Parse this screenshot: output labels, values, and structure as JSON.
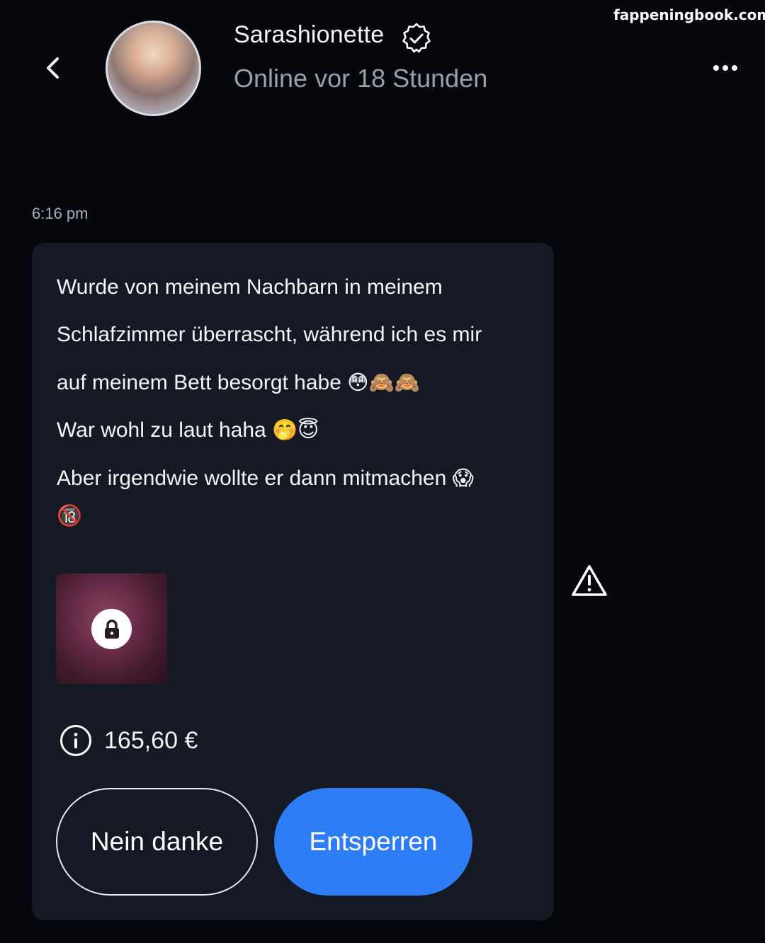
{
  "header": {
    "username": "Sarashionette",
    "status": "Online vor 18 Stunden",
    "back_icon": "chevron-left-icon",
    "more_icon": "more-horizontal-icon",
    "verified_icon": "verified-badge-icon"
  },
  "watermark": "fappeningbook.com",
  "message": {
    "timestamp": "6:16 pm",
    "lines": [
      "Wurde von meinem Nachbarn in meinem",
      "Schlafzimmer überrascht, während ich es mir",
      "auf meinem Bett besorgt habe",
      "War wohl zu laut haha",
      "Aber irgendwie wollte er dann mitmachen"
    ],
    "line_emojis": [
      "",
      "",
      "😳🙈🙈",
      "🤭😇",
      "😱"
    ],
    "extra_emoji": "🔞",
    "locked_media_icon": "lock-icon",
    "price_icon": "info-icon",
    "price": "165,60 €"
  },
  "actions": {
    "decline_label": "Nein danke",
    "unlock_label": "Entsperren",
    "report_icon": "warning-triangle-icon"
  },
  "colors": {
    "background": "#05070d",
    "bubble": "#141924",
    "accent": "#2d7df6",
    "muted_text": "#9aa0ab"
  }
}
